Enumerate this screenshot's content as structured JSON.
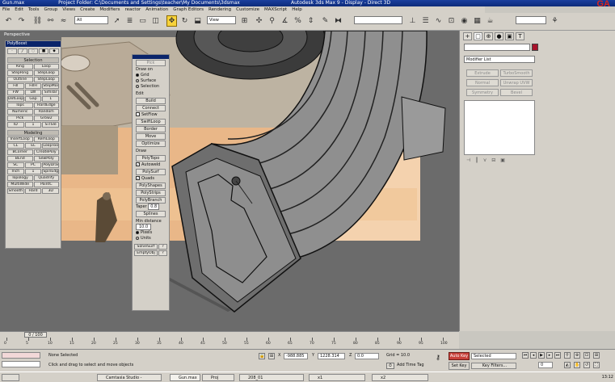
{
  "titlebar": {
    "path": "Project Folder: C:\\Documents and Settings\\teacher\\My Documents\\3dsmax",
    "title": "Autodesk 3ds Max 9   -   Display   -   Direct 3D",
    "file": "Gun.max"
  },
  "brand": {
    "text": "GA",
    "sub": "www.gamea.com.cn"
  },
  "menu": [
    "File",
    "Edit",
    "Tools",
    "Group",
    "Views",
    "Create",
    "Modifiers",
    "reactor",
    "Animation",
    "Graph Editors",
    "Rendering",
    "Customize",
    "MAXScript",
    "Help"
  ],
  "toolbar": {
    "filter": "All",
    "refcoord": "View",
    "namedsel": ""
  },
  "viewport": {
    "label": "Perspective"
  },
  "ribbon_panel": {
    "title": "PolyBoost",
    "selection_header": "Selection",
    "selection_rows": [
      [
        "Ring",
        "Loop"
      ],
      [
        "StepRing",
        "StepLoop"
      ],
      [
        "Outline",
        "StepLoop"
      ],
      [
        "Fill",
        "FillH",
        "StepMode"
      ],
      [
        "FW",
        "LW",
        "Similar"
      ],
      [
        "DotLoop",
        "Gap",
        "1"
      ],
      [
        "Tops",
        "HardEdge"
      ],
      [
        "Numeric",
        "Random"
      ],
      [
        "Pick",
        "Grow2"
      ],
      [
        "ID",
        "1",
        "SiTSle"
      ]
    ],
    "modeling_header": "Modeling",
    "modeling_rows": [
      [
        "InsertLoop",
        "RemLoop"
      ],
      [
        "CL",
        "EL",
        "LoopTools"
      ],
      [
        "BCorner",
        "CreatePoly"
      ],
      [
        "BEnd",
        "SewPoly"
      ],
      [
        "SC",
        "PC",
        "PolyDraw"
      ],
      [
        "Inch",
        "1",
        "SpinEdge"
      ],
      [
        "Topology",
        "Quadrify"
      ],
      [
        "MultiWide",
        "PaintC"
      ],
      [
        "Smooth",
        "Hard",
        "3D"
      ]
    ]
  },
  "draw_panel": {
    "top_button": "Pick",
    "draw_on_header": "Draw on",
    "draw_on": [
      "Grid",
      "Surface",
      "Selection"
    ],
    "draw_on_selected": "Grid",
    "edit_header": "Edit",
    "edit_buttons": [
      "Build",
      "Connect",
      "SwiftLoop",
      "Border",
      "Move",
      "Optimize"
    ],
    "setflow_label": "SetFlow",
    "draw_header": "Draw",
    "poly_topo": "PolyTopo",
    "autoweld": "Autoweld",
    "polysurf": "PolySurf",
    "quads": "Quads",
    "draw_buttons": [
      "PolyShapes",
      "PolyStrips",
      "PolyBranch"
    ],
    "taper_label": "Taper",
    "taper_value": "0.8",
    "splines": "Splines",
    "min_distance": "Min distance",
    "min_value": "10.0",
    "units": [
      "Pixels",
      "Units"
    ],
    "units_selected": "Pixels",
    "bottom_buttons": [
      [
        "SolveSurf",
        "?"
      ],
      [
        "EmptyObj",
        "?"
      ]
    ]
  },
  "command_panel": {
    "tabs": [
      "+",
      "□",
      "⊕",
      "●",
      "▣",
      "T"
    ],
    "modifier_list": "Modifier List",
    "mod_buttons": [
      [
        "Extrude",
        "TurboSmooth"
      ],
      [
        "Normal",
        "Unwrap UVW"
      ],
      [
        "Symmetry",
        "Bevel"
      ]
    ],
    "accent": "#a8122a"
  },
  "timeline": {
    "frame": "0 / 100",
    "ticks": [
      "0",
      "5",
      "10",
      "15",
      "20",
      "25",
      "30",
      "35",
      "40",
      "45",
      "50",
      "55",
      "60",
      "65",
      "70",
      "75",
      "80",
      "85",
      "90",
      "95",
      "100"
    ]
  },
  "status": {
    "maxscript": "",
    "selection": "None Selected",
    "prompt": "Click and drag to select and move objects",
    "x_label": "X",
    "x": "-988.885",
    "y_label": "Y",
    "y": "1228.314",
    "z_label": "Z",
    "z": "0.0",
    "grid": "Grid = 10.0",
    "add_time_tag": "Add Time Tag",
    "auto_key": "Auto Key",
    "set_key": "Set Key",
    "selected": "Selected",
    "key_filters": "Key Filters...",
    "frame_field": "0"
  },
  "taskbar": {
    "start": "",
    "tasks": [
      "Camtasia Studio -",
      "Gun.max",
      "Proj",
      "208_01",
      "x1",
      "x2"
    ],
    "active": 1,
    "tray": "13:12"
  }
}
